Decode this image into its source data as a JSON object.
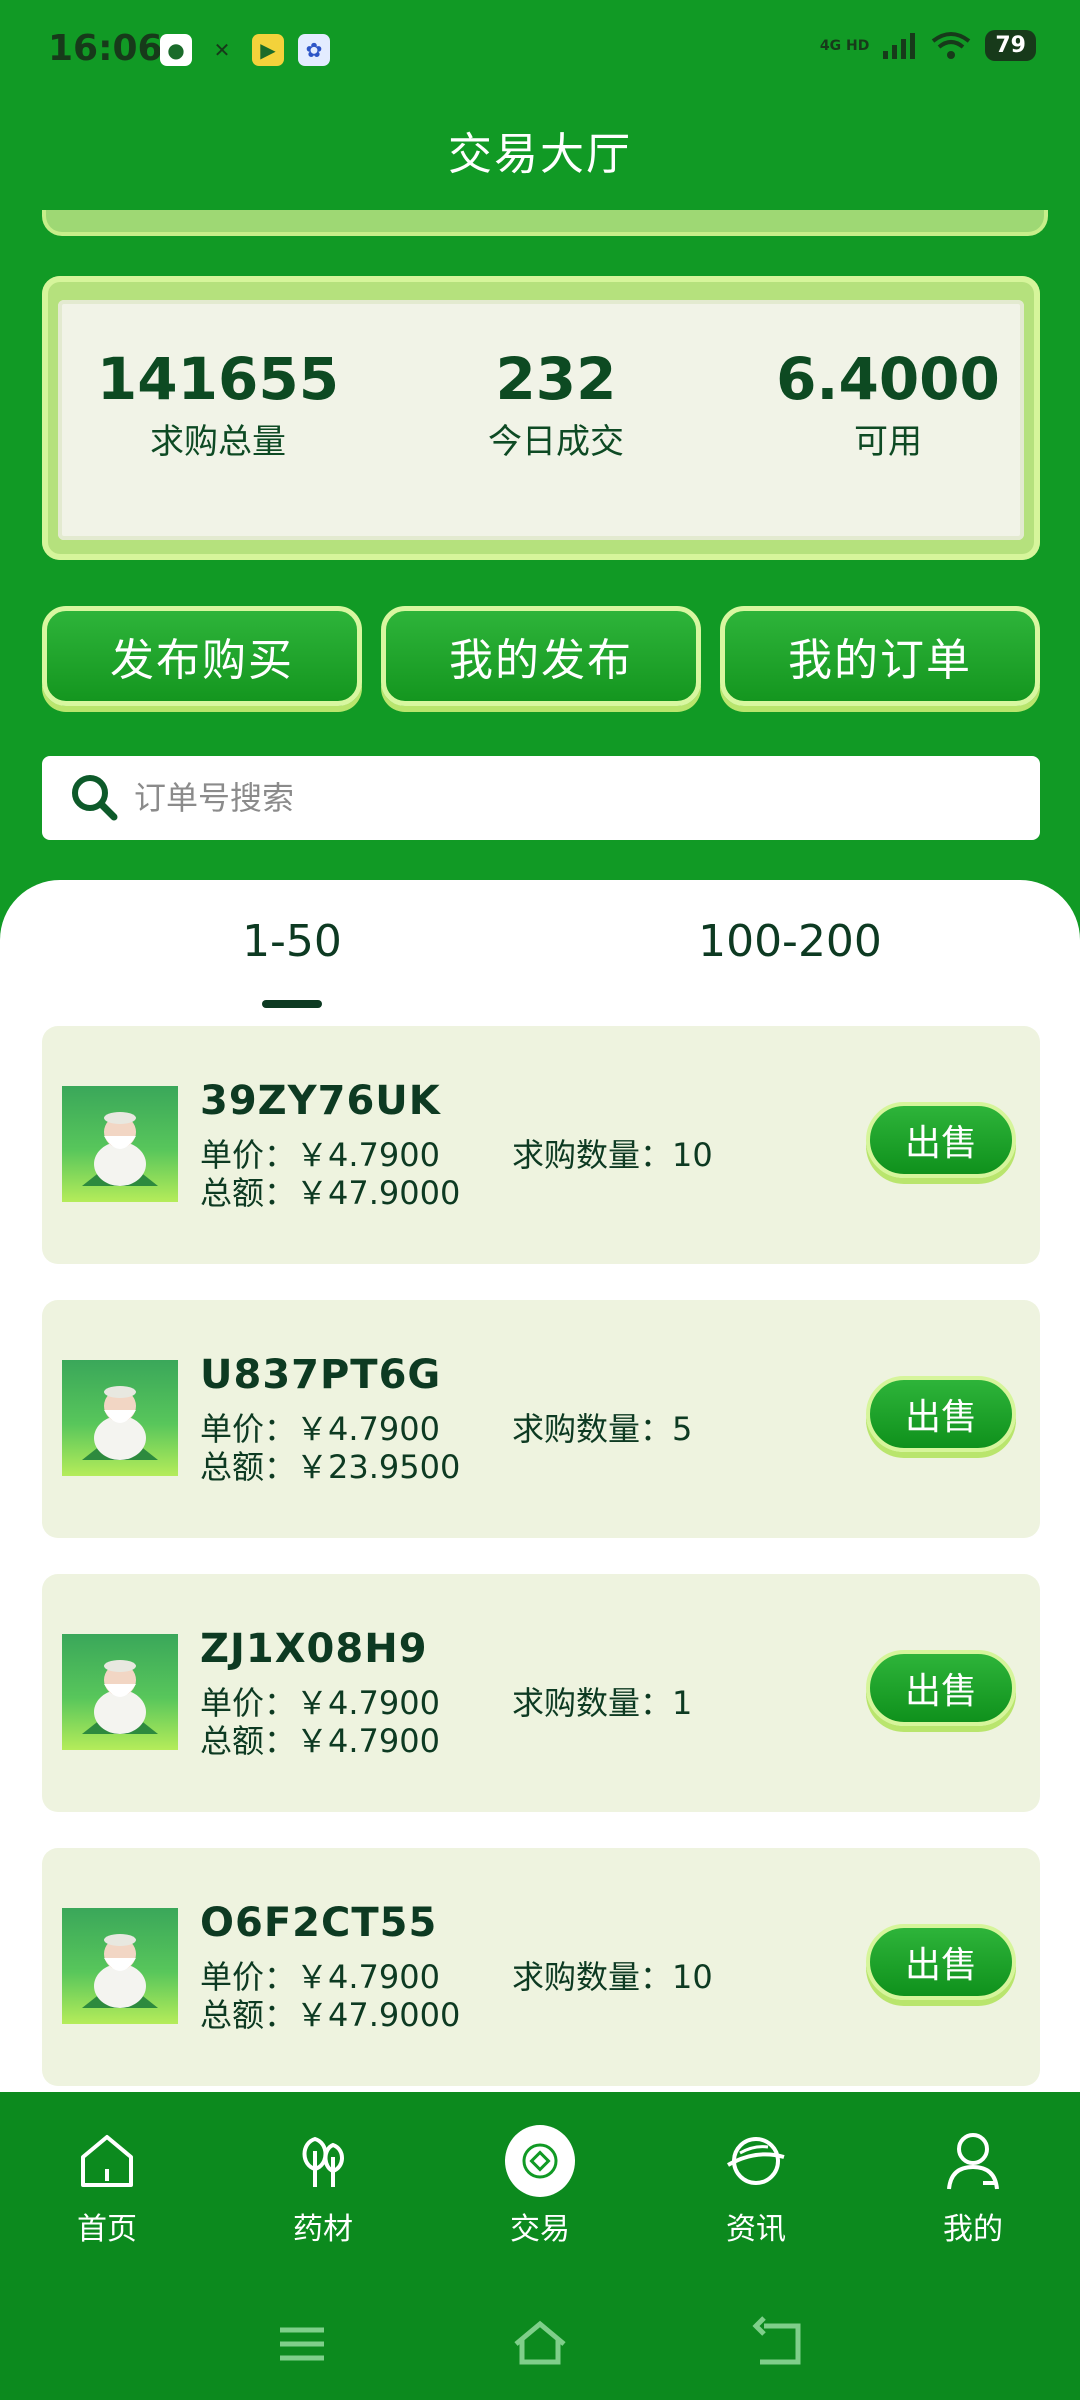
{
  "status": {
    "time": "16:06",
    "network_top": "4G HD",
    "battery": "79"
  },
  "title": "交易大厅",
  "stats": [
    {
      "value": "141655",
      "label": "求购总量"
    },
    {
      "value": "232",
      "label": "今日成交"
    },
    {
      "value": "6.4000",
      "label": "可用"
    }
  ],
  "actions": [
    "发布购买",
    "我的发布",
    "我的订单"
  ],
  "search": {
    "placeholder": "订单号搜索"
  },
  "tabs": [
    "1-50",
    "100-200"
  ],
  "orders": [
    {
      "id": "39ZY76UK",
      "price": "单价：￥4.7900",
      "total": "总额：￥47.9000",
      "qty": "求购数量：10",
      "action": "出售"
    },
    {
      "id": "U837PT6G",
      "price": "单价：￥4.7900",
      "total": "总额：￥23.9500",
      "qty": "求购数量：5",
      "action": "出售"
    },
    {
      "id": "ZJ1X08H9",
      "price": "单价：￥4.7900",
      "total": "总额：￥4.7900",
      "qty": "求购数量：1",
      "action": "出售"
    },
    {
      "id": "O6F2CT55",
      "price": "单价：￥4.7900",
      "total": "总额：￥47.9000",
      "qty": "求购数量：10",
      "action": "出售"
    }
  ],
  "tabbar": [
    "首页",
    "药材",
    "交易",
    "资讯",
    "我的"
  ]
}
